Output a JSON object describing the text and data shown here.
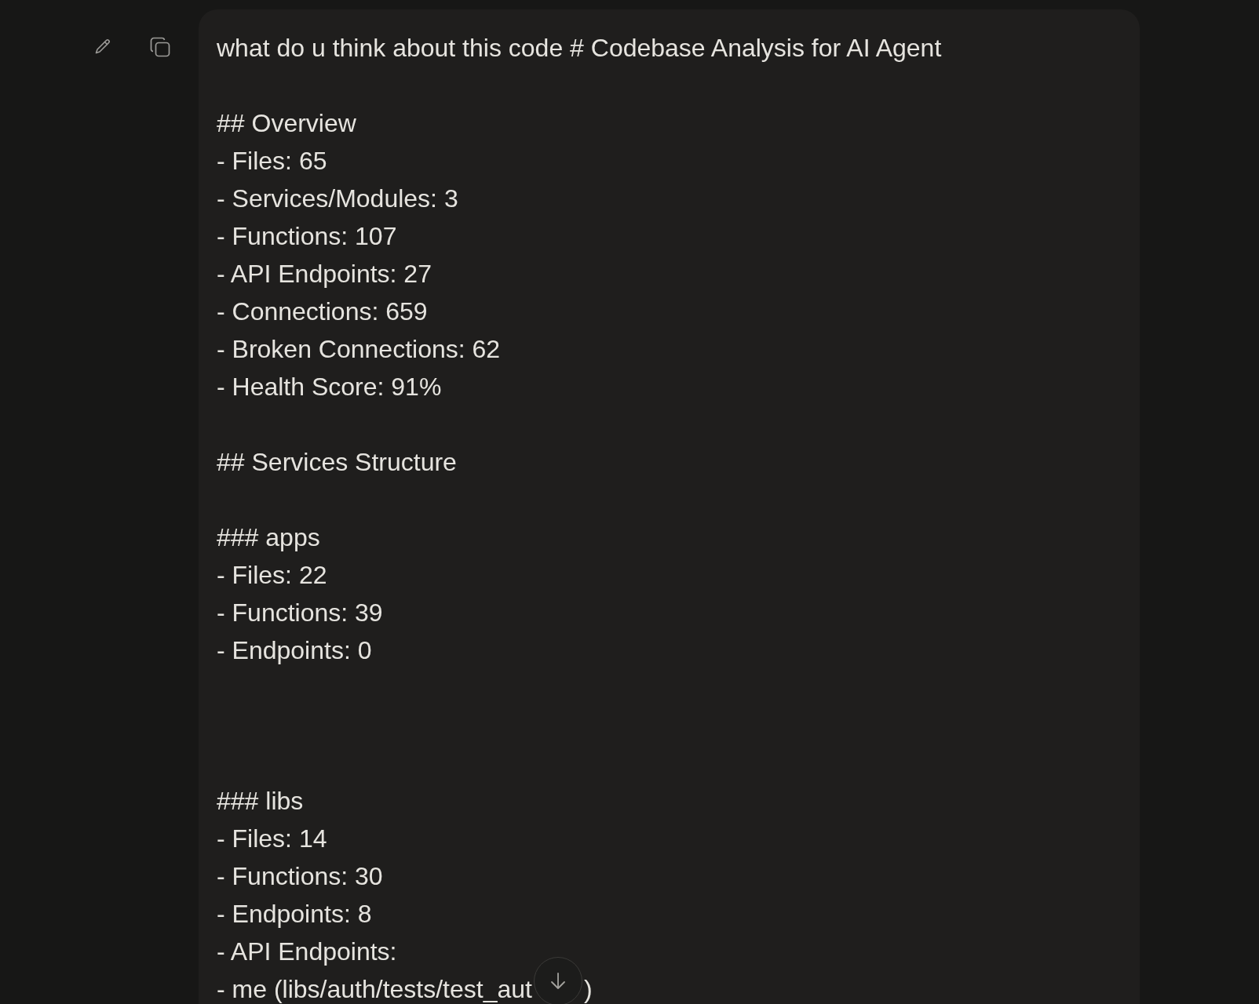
{
  "message": {
    "lines": [
      {
        "kind": "text",
        "text": "what do u think about this code # Codebase Analysis for AI Agent"
      },
      {
        "kind": "blank"
      },
      {
        "kind": "text",
        "text": "## Overview"
      },
      {
        "kind": "text",
        "text": "- Files: 65"
      },
      {
        "kind": "text",
        "text": "- Services/Modules: 3"
      },
      {
        "kind": "text",
        "text": "- Functions: 107"
      },
      {
        "kind": "text",
        "text": "- API Endpoints: 27"
      },
      {
        "kind": "text",
        "text": "- Connections: 659"
      },
      {
        "kind": "text",
        "text": "- Broken Connections: 62"
      },
      {
        "kind": "text",
        "text": "- Health Score: 91%"
      },
      {
        "kind": "blank"
      },
      {
        "kind": "text",
        "text": "## Services Structure"
      },
      {
        "kind": "blank"
      },
      {
        "kind": "text",
        "text": "### apps"
      },
      {
        "kind": "text",
        "text": "- Files: 22"
      },
      {
        "kind": "text",
        "text": "- Functions: 39"
      },
      {
        "kind": "text",
        "text": "- Endpoints: 0"
      },
      {
        "kind": "blank"
      },
      {
        "kind": "blank"
      },
      {
        "kind": "blank"
      },
      {
        "kind": "text",
        "text": "### libs"
      },
      {
        "kind": "text",
        "text": "- Files: 14"
      },
      {
        "kind": "text",
        "text": "- Functions: 30"
      },
      {
        "kind": "text",
        "text": "- Endpoints: 8"
      },
      {
        "kind": "text",
        "text": "- API Endpoints:"
      },
      {
        "kind": "covered",
        "parts": [
          "- me (libs/auth/tests/test_aut",
          ")"
        ]
      }
    ]
  }
}
